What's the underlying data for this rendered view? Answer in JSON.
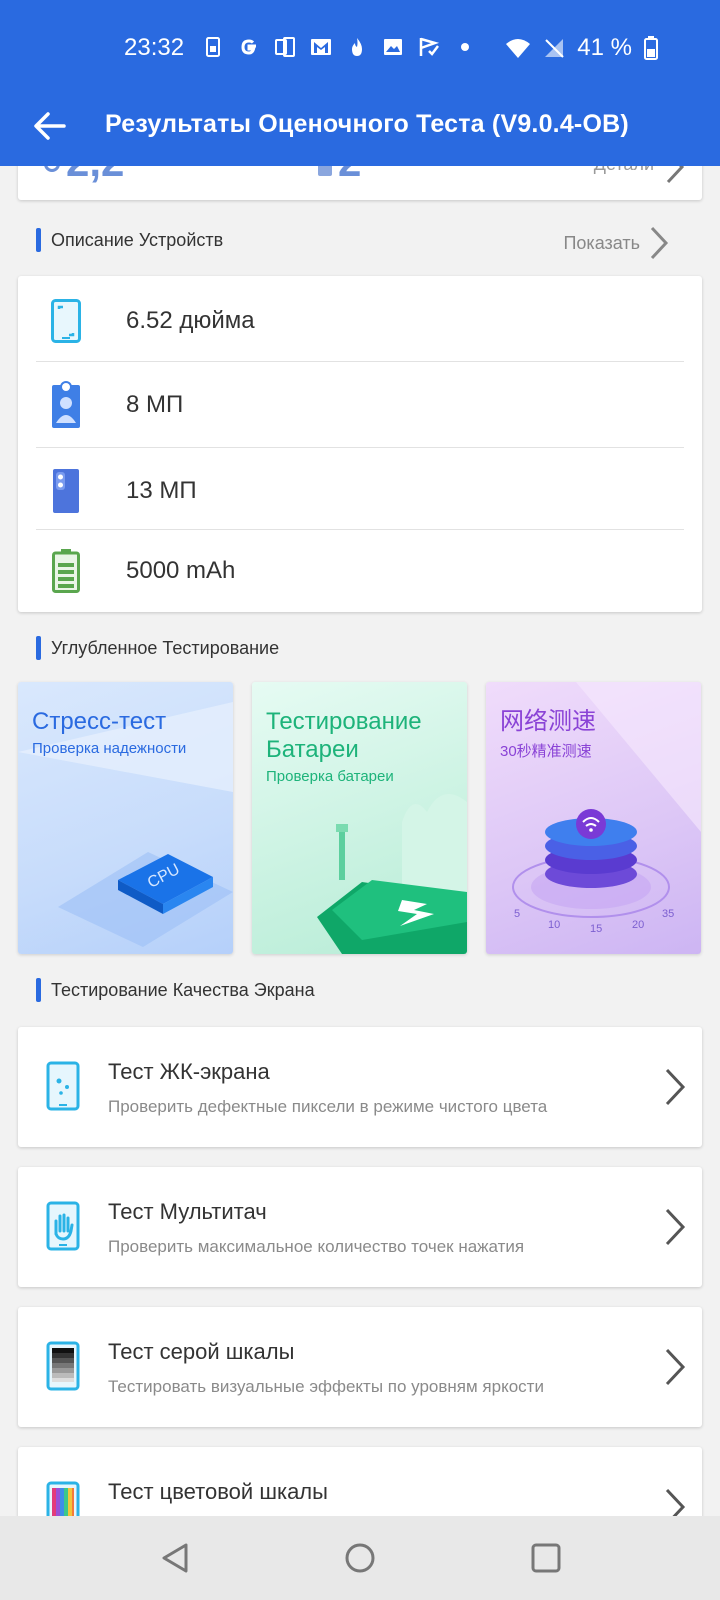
{
  "status": {
    "time": "23:32",
    "battery": "41 %"
  },
  "appbar": {
    "title": "Результаты Оценочного Теста (V9.0.4-OB)"
  },
  "summary": {
    "score_partial": "2,2",
    "value_partial": "2",
    "details": "Детали"
  },
  "device": {
    "section_title": "Описание Устройств",
    "show": "Показать",
    "specs": [
      {
        "icon": "screen-size-icon",
        "value": "6.52 дюйма"
      },
      {
        "icon": "front-camera-icon",
        "value": "8 МП"
      },
      {
        "icon": "rear-camera-icon",
        "value": "13 МП"
      },
      {
        "icon": "battery-icon",
        "value": "5000 mAh"
      }
    ]
  },
  "deep": {
    "section_title": "Углубленное Тестирование",
    "tiles": [
      {
        "title": "Стресс-тест",
        "subtitle": "Проверка надежности",
        "art_label": "CPU",
        "color": "#2a6ae0"
      },
      {
        "title": "Тестирование Батареи",
        "subtitle": "Проверка батареи",
        "color": "#1db37a"
      },
      {
        "title": "网络测速",
        "subtitle": "30秒精准测速",
        "color": "#8a43d6",
        "scale": [
          "5",
          "10",
          "15",
          "20",
          "35"
        ]
      }
    ]
  },
  "screen": {
    "section_title": "Тестирование Качества Экрана",
    "tests": [
      {
        "name": "Тест ЖК-экрана",
        "desc": "Проверить дефектные пиксели в режиме чистого цвета"
      },
      {
        "name": "Тест Мультитач",
        "desc": "Проверить максимальное количество точек нажатия"
      },
      {
        "name": "Тест серой шкалы",
        "desc": "Тестировать визуальные эффекты по уровням яркости"
      },
      {
        "name": "Тест цветовой шкалы",
        "desc": ""
      }
    ]
  },
  "colors": {
    "accent": "#2a6ae0"
  }
}
